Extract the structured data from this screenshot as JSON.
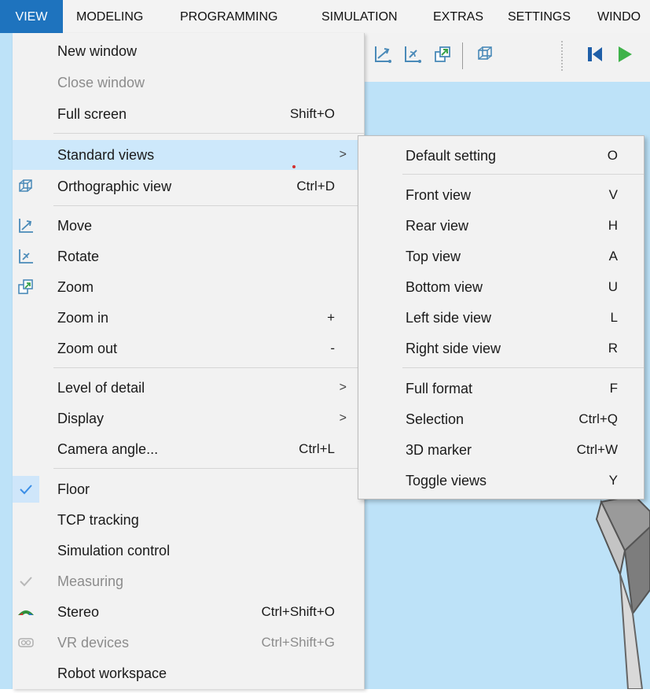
{
  "menubar": {
    "items": [
      "VIEW",
      "MODELING",
      "PROGRAMMING",
      "SIMULATION",
      "EXTRAS",
      "SETTINGS",
      "WINDO"
    ]
  },
  "toolbar": {
    "icons": [
      "move-icon",
      "rotate-icon",
      "zoom-icon",
      "orthographic-view-icon",
      "step-back-icon",
      "play-icon"
    ]
  },
  "view_menu": {
    "items": [
      {
        "label": "New window",
        "shortcut": "",
        "enabled": true
      },
      {
        "label": "Close window",
        "shortcut": "",
        "enabled": false
      },
      {
        "label": "Full screen",
        "shortcut": "Shift+O",
        "enabled": true
      },
      {
        "label": "Standard views",
        "shortcut": "",
        "submenu": true,
        "highlighted": true,
        "enabled": true
      },
      {
        "label": "Orthographic view",
        "shortcut": "Ctrl+D",
        "icon": "orthographic-view-icon",
        "enabled": true
      },
      {
        "label": "Move",
        "shortcut": "",
        "icon": "move-icon",
        "enabled": true
      },
      {
        "label": "Rotate",
        "shortcut": "",
        "icon": "rotate-icon",
        "enabled": true
      },
      {
        "label": "Zoom",
        "shortcut": "",
        "icon": "zoom-icon",
        "enabled": true
      },
      {
        "label": "Zoom in",
        "shortcut": "+",
        "enabled": true
      },
      {
        "label": "Zoom out",
        "shortcut": "-",
        "enabled": true
      },
      {
        "label": "Level of detail",
        "shortcut": "",
        "submenu": true,
        "enabled": true
      },
      {
        "label": "Display",
        "shortcut": "",
        "submenu": true,
        "enabled": true
      },
      {
        "label": "Camera angle...",
        "shortcut": "Ctrl+L",
        "enabled": true
      },
      {
        "label": "Floor",
        "shortcut": "",
        "checked": true,
        "icon": "checkmark-icon",
        "enabled": true
      },
      {
        "label": "TCP tracking",
        "shortcut": "",
        "enabled": true
      },
      {
        "label": "Simulation control",
        "shortcut": "",
        "enabled": true
      },
      {
        "label": "Measuring",
        "shortcut": "",
        "checked": true,
        "icon": "checkmark-icon",
        "enabled": false
      },
      {
        "label": "Stereo",
        "shortcut": "Ctrl+Shift+O",
        "icon": "stereo-glasses-icon",
        "enabled": true
      },
      {
        "label": "VR devices",
        "shortcut": "Ctrl+Shift+G",
        "icon": "vr-headset-icon",
        "enabled": false
      },
      {
        "label": "Robot workspace",
        "shortcut": "",
        "enabled": true
      }
    ],
    "submenu_arrow": ">"
  },
  "standard_views_submenu": {
    "items": [
      {
        "label": "Default setting",
        "shortcut": "O"
      },
      {
        "label": "Front view",
        "shortcut": "V"
      },
      {
        "label": "Rear view",
        "shortcut": "H"
      },
      {
        "label": "Top view",
        "shortcut": "A"
      },
      {
        "label": "Bottom view",
        "shortcut": "U"
      },
      {
        "label": "Left side view",
        "shortcut": "L"
      },
      {
        "label": "Right side view",
        "shortcut": "R"
      },
      {
        "label": "Full format",
        "shortcut": "F"
      },
      {
        "label": "Selection",
        "shortcut": "Ctrl+Q"
      },
      {
        "label": "3D marker",
        "shortcut": "Ctrl+W"
      },
      {
        "label": "Toggle views",
        "shortcut": "Y"
      }
    ]
  },
  "colors": {
    "menubar_active": "#1e73be",
    "menu_highlight": "#cde8fb",
    "workspace": "#bde2f8",
    "check_blue": "#3a8ee6"
  }
}
